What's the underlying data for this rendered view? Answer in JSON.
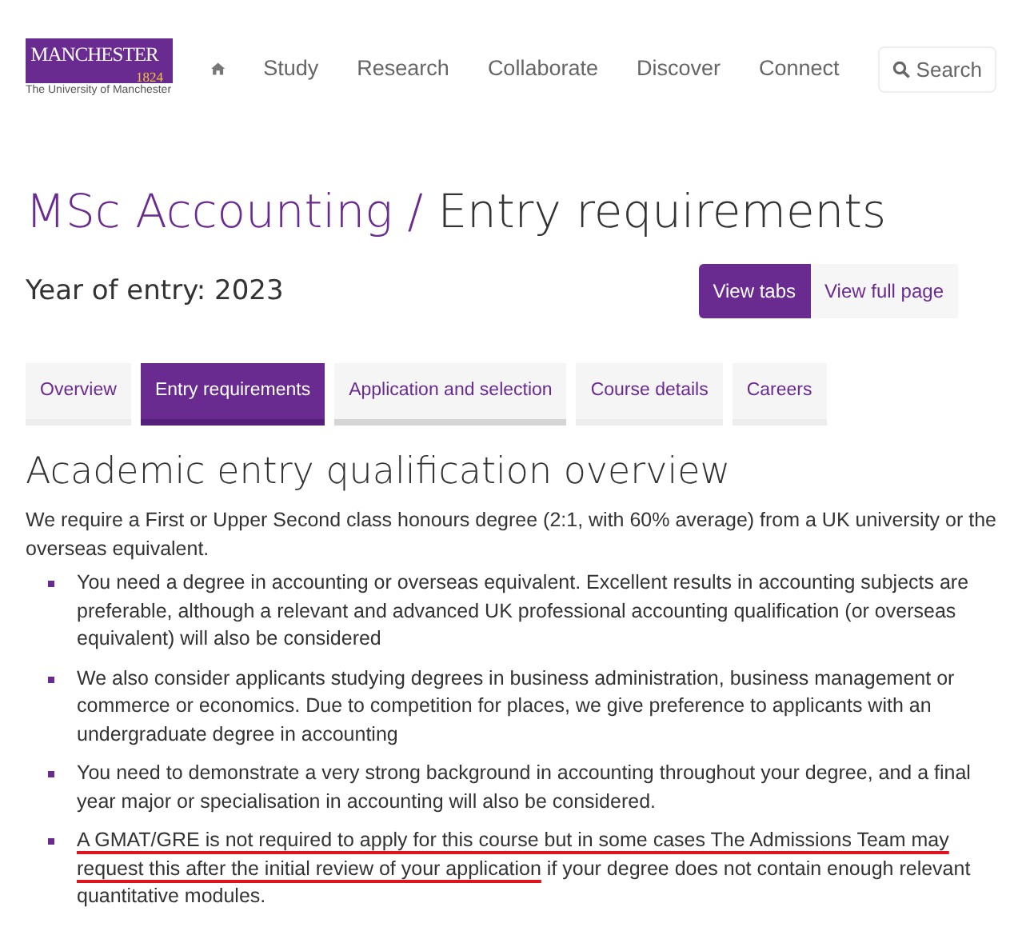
{
  "logo": {
    "name": "MANCHESTER",
    "year": "1824",
    "subtitle": "The University of Manchester"
  },
  "nav": {
    "items": [
      "Study",
      "Research",
      "Collaborate",
      "Discover",
      "Connect"
    ],
    "search": "Search"
  },
  "title": {
    "course": "MSc Accounting /",
    "section": "Entry requirements"
  },
  "year_of_entry": "Year of entry: 2023",
  "view_buttons": [
    {
      "label": "View tabs",
      "selected": true
    },
    {
      "label": "View full page",
      "selected": false
    }
  ],
  "tabs": [
    {
      "label": "Overview",
      "selected": false,
      "hovered": false
    },
    {
      "label": "Entry requirements",
      "selected": true,
      "hovered": false
    },
    {
      "label": "Application and selection",
      "selected": false,
      "hovered": true
    },
    {
      "label": "Course details",
      "selected": false,
      "hovered": false
    },
    {
      "label": "Careers",
      "selected": false,
      "hovered": false
    }
  ],
  "heading": "Academic entry qualification overview",
  "intro": "We require a First or Upper Second class honours degree (2:1, with 60% average) from a UK university or the overseas equivalent.",
  "bullets": [
    {
      "text": "You need a degree in accounting or overseas equivalent. Excellent results in accounting subjects are preferable, although a relevant and advanced UK professional accounting qualification (or overseas equivalent) will also be considered"
    },
    {
      "text": "We also consider applicants studying degrees in business administration, business management or commerce or economics. Due to competition for places, we give preference to applicants with an undergraduate degree in accounting"
    },
    {
      "text": "You need to demonstrate a very strong background in accounting throughout your degree, and a final year major or specialisation in accounting will also be considered."
    },
    {
      "underlined": "A GMAT/GRE is not required to apply for this course but in some cases The Admissions Team may request this after the initial review of your application",
      "text": " if your degree does not contain enough relevant quantitative modules."
    }
  ]
}
